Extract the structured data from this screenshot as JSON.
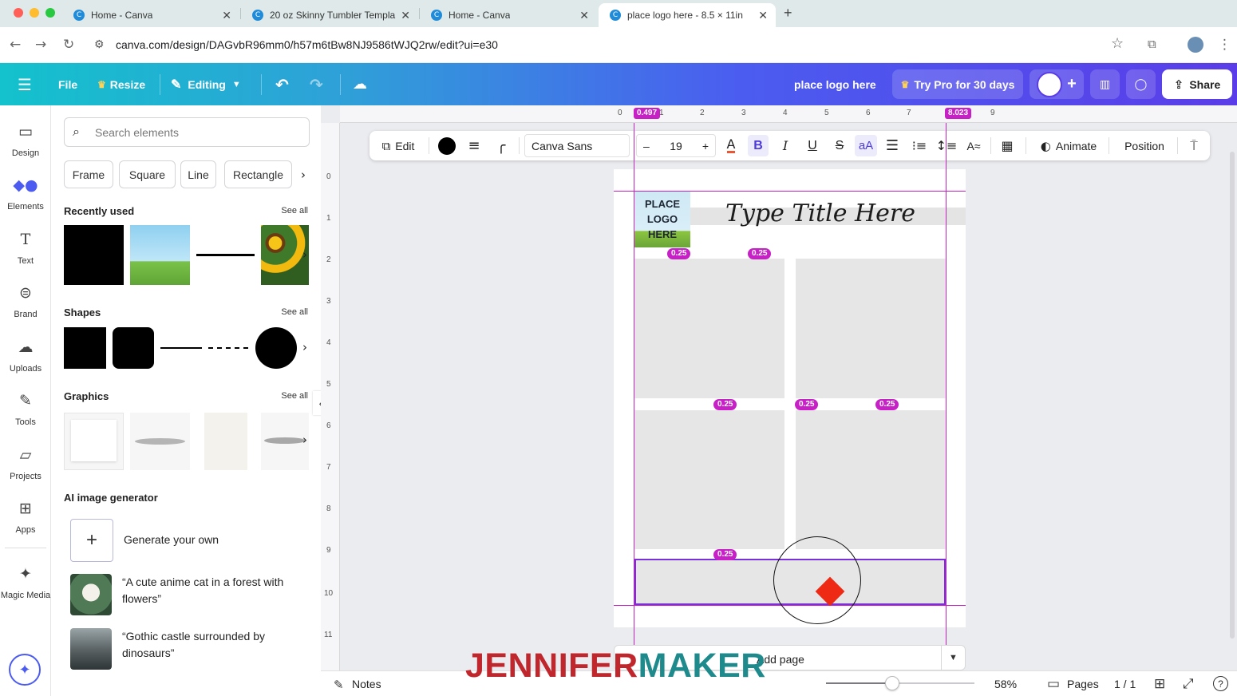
{
  "browser": {
    "tabs": [
      {
        "title": "Home - Canva"
      },
      {
        "title": "20 oz Skinny Tumbler Templa"
      },
      {
        "title": "Home - Canva"
      },
      {
        "title": "place logo here - 8.5 × 11in"
      }
    ],
    "new_tab_symbol": "+",
    "url": "canva.com/design/DAGvbR96mm0/h57m6tBw8NJ9586tWJQ2rw/edit?ui=e30"
  },
  "header": {
    "file": "File",
    "resize": "Resize",
    "editing": "Editing",
    "design_title": "place logo here",
    "try_pro": "Try Pro for 30 days",
    "share": "Share",
    "gradient_start": "#13c2cc",
    "gradient_end": "#5a3de8"
  },
  "rail": [
    {
      "label": "Design",
      "icon": "design-icon"
    },
    {
      "label": "Elements",
      "icon": "elements-icon"
    },
    {
      "label": "Text",
      "icon": "text-icon"
    },
    {
      "label": "Brand",
      "icon": "brand-icon"
    },
    {
      "label": "Uploads",
      "icon": "uploads-icon"
    },
    {
      "label": "Tools",
      "icon": "tools-icon"
    },
    {
      "label": "Projects",
      "icon": "projects-icon"
    },
    {
      "label": "Apps",
      "icon": "apps-icon"
    },
    {
      "label": "Magic Media",
      "icon": "magic-media-icon"
    }
  ],
  "panel": {
    "search_placeholder": "Search elements",
    "chips": [
      "Frame",
      "Square",
      "Line",
      "Rectangle"
    ],
    "recently_used": "Recently used",
    "shapes": "Shapes",
    "graphics": "Graphics",
    "see_all": "See all",
    "ai_title": "AI image generator",
    "generate_own": "Generate your own",
    "prompt_1": "“A cute anime cat in a forest with flowers”",
    "prompt_2": "“Gothic castle surrounded by dinosaurs”"
  },
  "ruler": {
    "top_ticks": [
      "0",
      "1",
      "2",
      "3",
      "4",
      "5",
      "6",
      "7",
      "8",
      "9"
    ],
    "left_ticks": [
      "0",
      "1",
      "2",
      "3",
      "4",
      "5",
      "6",
      "7",
      "8",
      "9",
      "10",
      "11"
    ],
    "mark_left": "0.497",
    "mark_right": "8.023"
  },
  "toolbar": {
    "edit": "Edit",
    "font": "Canva Sans",
    "font_size": "19",
    "minus": "–",
    "plus": "+",
    "case": "aA",
    "animate": "Animate",
    "position": "Position",
    "text_color": "#000000"
  },
  "canvas": {
    "logo_text": "PLACE\nLOGO\nHERE",
    "title_text": "Type Title Here",
    "gap_label": "0.25",
    "add_page": "Add page"
  },
  "bottom": {
    "notes": "Notes",
    "zoom": "58%",
    "pages": "Pages",
    "page_count": "1 / 1"
  },
  "watermark": {
    "part1": "JENNIFER",
    "part2": "MAKER",
    "color1": "#c0272d",
    "color2": "#1e8a8c"
  }
}
